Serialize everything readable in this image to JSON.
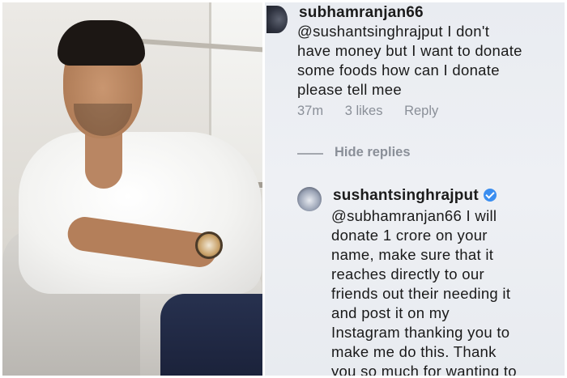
{
  "photo": {
    "subject": "man in white shirt sitting in chair"
  },
  "comments": [
    {
      "username": "subhamranjan66",
      "text": "@sushantsinghrajput I don't\nhave money but I want to donate\nsome foods how can I donate\nplease tell mee",
      "time": "37m",
      "likes": "3 likes",
      "reply_label": "Reply"
    },
    {
      "username": "sushantsinghrajput",
      "verified_icon": "verified-badge-icon",
      "text": "@subhamranjan66 I will\ndonate 1 crore on your\nname, make sure that it\nreaches directly to our\nfriends out their needing it\nand post it on my\nInstagram thanking you to\nmake me do this. Thank\nyou so much for wanting to"
    }
  ],
  "hide_replies_label": "Hide replies",
  "colors": {
    "background": "#eceff3",
    "text": "#1a1a1a",
    "meta": "#8a8f98",
    "verified": "#3b8ef0"
  }
}
